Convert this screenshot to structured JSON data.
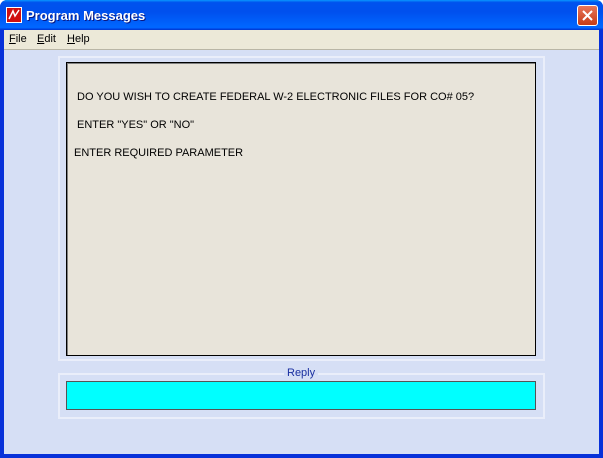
{
  "window": {
    "title": "Program Messages",
    "icon": "app-icon",
    "close_icon": "close-icon"
  },
  "menu": {
    "items": [
      {
        "label_u": "F",
        "label_rest": "ile"
      },
      {
        "label_u": "E",
        "label_rest": "dit"
      },
      {
        "label_u": "H",
        "label_rest": "elp"
      }
    ]
  },
  "messages": {
    "lines": [
      "DO YOU WISH TO CREATE FEDERAL W-2 ELECTRONIC FILES FOR CO# 05?",
      "ENTER \"YES\" OR \"NO\"",
      "ENTER REQUIRED PARAMETER"
    ]
  },
  "reply": {
    "label": "Reply",
    "value": ""
  },
  "colors": {
    "reply_bg": "#00ffff",
    "message_bg": "#e8e4da",
    "client_bg": "#d6dff5"
  }
}
